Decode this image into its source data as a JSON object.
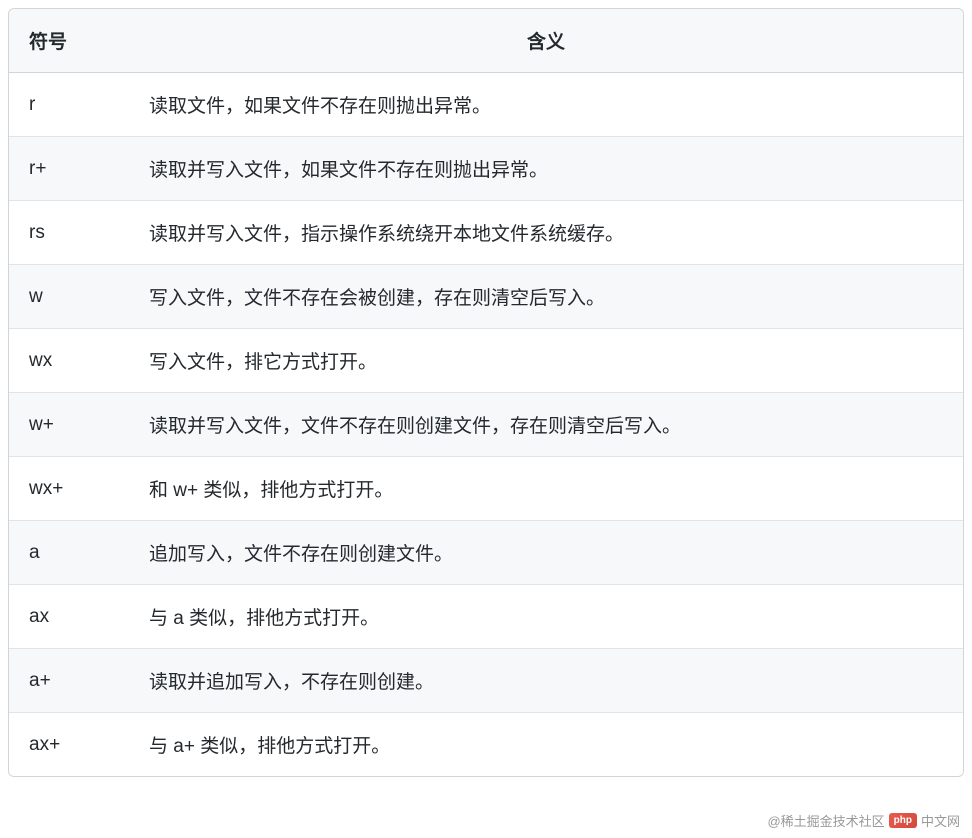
{
  "table": {
    "headers": {
      "symbol": "符号",
      "meaning": "含义"
    },
    "rows": [
      {
        "symbol": "r",
        "meaning": "读取文件，如果文件不存在则抛出异常。"
      },
      {
        "symbol": "r+",
        "meaning": "读取并写入文件，如果文件不存在则抛出异常。"
      },
      {
        "symbol": "rs",
        "meaning": "读取并写入文件，指示操作系统绕开本地文件系统缓存。"
      },
      {
        "symbol": "w",
        "meaning": "写入文件，文件不存在会被创建，存在则清空后写入。"
      },
      {
        "symbol": "wx",
        "meaning": "写入文件，排它方式打开。"
      },
      {
        "symbol": "w+",
        "meaning": "读取并写入文件，文件不存在则创建文件，存在则清空后写入。"
      },
      {
        "symbol": "wx+",
        "meaning": "和 w+ 类似，排他方式打开。"
      },
      {
        "symbol": "a",
        "meaning": "追加写入，文件不存在则创建文件。"
      },
      {
        "symbol": "ax",
        "meaning": "与 a 类似，排他方式打开。"
      },
      {
        "symbol": "a+",
        "meaning": "读取并追加写入，不存在则创建。"
      },
      {
        "symbol": "ax+",
        "meaning": "与 a+ 类似，排他方式打开。"
      }
    ]
  },
  "watermark": {
    "text1": "@稀土掘金技术社区",
    "badge": "php",
    "text2": "中文网"
  }
}
